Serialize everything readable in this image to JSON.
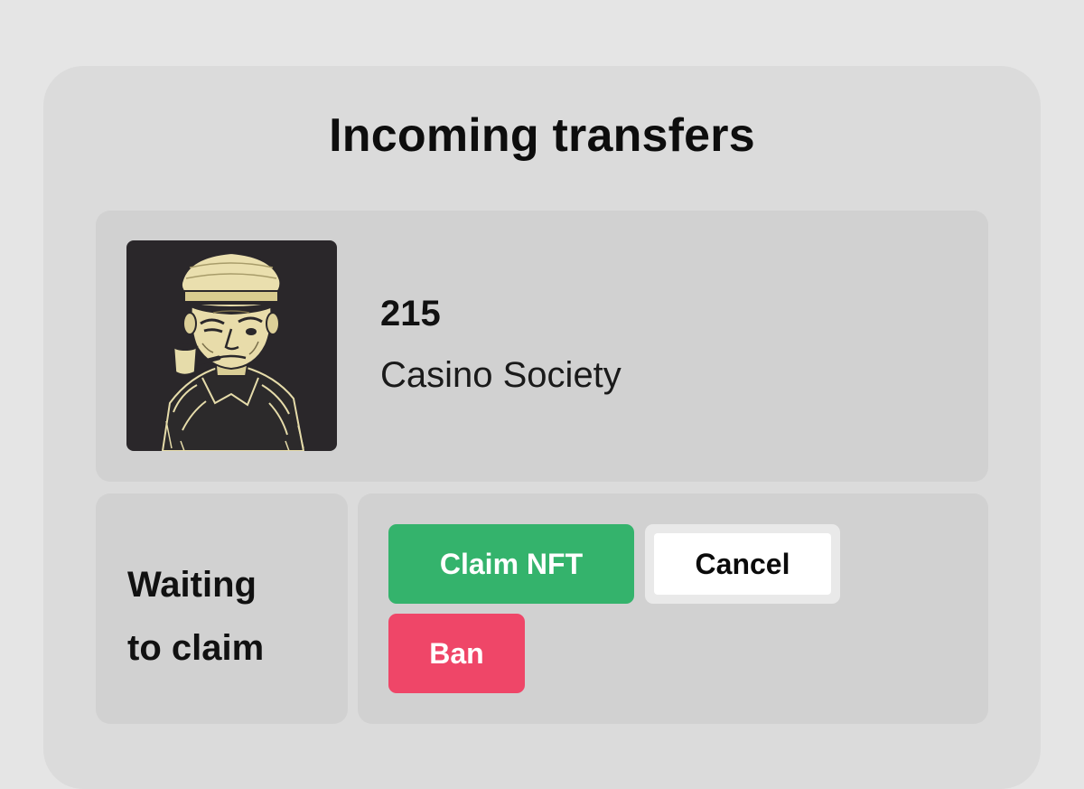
{
  "page": {
    "title": "Incoming transfers"
  },
  "transfer": {
    "nft_id": "215",
    "collection": "Casino Society",
    "image_icon": "sailor-portrait-illustration",
    "status": "Waiting\nto claim"
  },
  "actions": {
    "claim_label": "Claim NFT",
    "cancel_label": "Cancel",
    "ban_label": "Ban"
  },
  "colors": {
    "background": "#e5e5e5",
    "panel": "#dbdbdb",
    "card": "#d1d1d1",
    "claim": "#34b36c",
    "cancel": "#ffffff",
    "ban": "#ef4668"
  }
}
